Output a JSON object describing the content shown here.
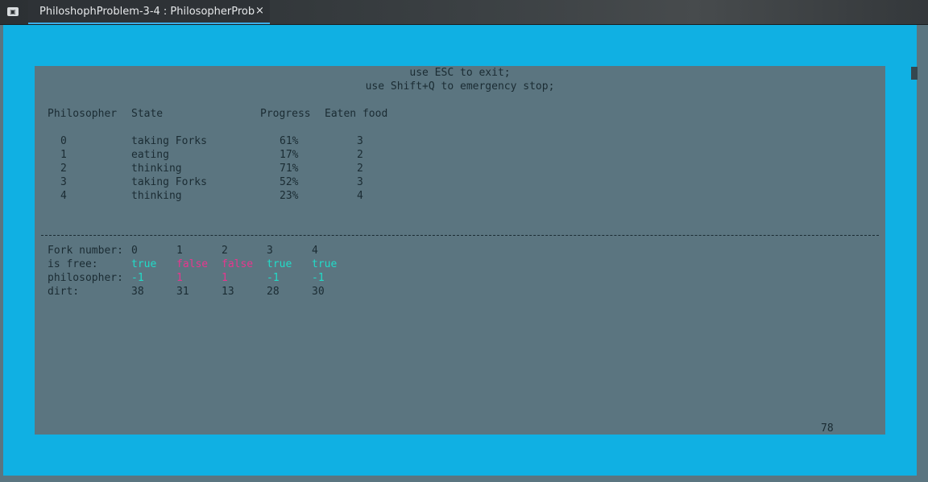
{
  "window": {
    "tab_title": "PhiloshophProblem-3-4 : PhilosopherProb",
    "close_glyph": "×",
    "app_icon": "terminal-icon"
  },
  "colors": {
    "terminal_bg": "#10b0e3",
    "screen_bg": "#5b7580",
    "text": "#1b2c33",
    "true_value": "#21dcc8",
    "false_value": "#e8368e"
  },
  "header": {
    "exit_hint": "use ESC to exit;",
    "stop_hint": "use Shift+Q to emergency stop;"
  },
  "philosophers": {
    "columns": [
      "Philosopher",
      "State",
      "Progress",
      "Eaten food"
    ],
    "rows": [
      {
        "id": "0",
        "state": "taking Forks",
        "progress": "61%",
        "eaten": "3"
      },
      {
        "id": "1",
        "state": "eating",
        "progress": "17%",
        "eaten": "2"
      },
      {
        "id": "2",
        "state": "thinking",
        "progress": "71%",
        "eaten": "2"
      },
      {
        "id": "3",
        "state": "taking Forks",
        "progress": "52%",
        "eaten": "3"
      },
      {
        "id": "4",
        "state": "thinking",
        "progress": "23%",
        "eaten": "4"
      }
    ]
  },
  "forks": {
    "labels": {
      "number": "Fork number:",
      "free": "is free:",
      "philosopher": "philosopher:",
      "dirt": "dirt:"
    },
    "numbers": [
      "0",
      "1",
      "2",
      "3",
      "4"
    ],
    "is_free": [
      "true",
      "false",
      "false",
      "true",
      "true"
    ],
    "philosopher": [
      "-1",
      "1",
      "1",
      "-1",
      "-1"
    ],
    "dirt": [
      "38",
      "31",
      "13",
      "28",
      "30"
    ]
  },
  "footer": {
    "counter": "78"
  }
}
